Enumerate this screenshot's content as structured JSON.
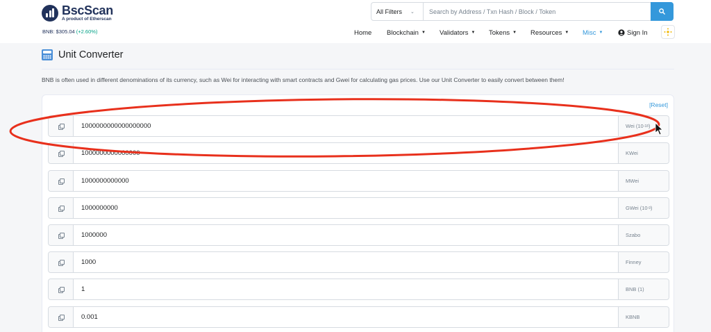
{
  "header": {
    "logo_name": "BscScan",
    "logo_sub": "A product of Etherscan",
    "price_label": "BNB: $305.04",
    "price_change": "(+2.60%)",
    "filter_label": "All Filters",
    "search_placeholder": "Search by Address / Txn Hash / Block / Token",
    "nav": [
      {
        "label": "Home"
      },
      {
        "label": "Blockchain"
      },
      {
        "label": "Validators"
      },
      {
        "label": "Tokens"
      },
      {
        "label": "Resources"
      },
      {
        "label": "Misc"
      },
      {
        "label": "Sign In"
      }
    ]
  },
  "page": {
    "title": "Unit Converter",
    "description": "BNB is often used in different denominations of its currency, such as Wei for interacting with smart contracts and Gwei for calculating gas prices. Use our Unit Converter to easily convert between them!",
    "reset_label": "[Reset]"
  },
  "rows": [
    {
      "value": "1000000000000000000",
      "unit": "Wei",
      "exp": "-18"
    },
    {
      "value": "1000000000000000",
      "unit": "KWei",
      "exp": ""
    },
    {
      "value": "1000000000000",
      "unit": "MWei",
      "exp": ""
    },
    {
      "value": "1000000000",
      "unit": "GWei",
      "exp": "-9"
    },
    {
      "value": "1000000",
      "unit": "Szabo",
      "exp": ""
    },
    {
      "value": "1000",
      "unit": "Finney",
      "exp": ""
    },
    {
      "value": "1",
      "unit": "BNB (1)",
      "exp": ""
    },
    {
      "value": "0.001",
      "unit": "KBNB",
      "exp": ""
    }
  ],
  "icons": {
    "search": "search-icon",
    "copy": "copy-icon",
    "calculator": "calculator-icon",
    "user": "user-circle-icon",
    "bnb": "bnb-logo-icon"
  },
  "colors": {
    "brand": "#21325b",
    "accent": "#3498db",
    "positive": "#00a186",
    "annotation": "#e8301c",
    "bnb": "#f0b90b"
  }
}
